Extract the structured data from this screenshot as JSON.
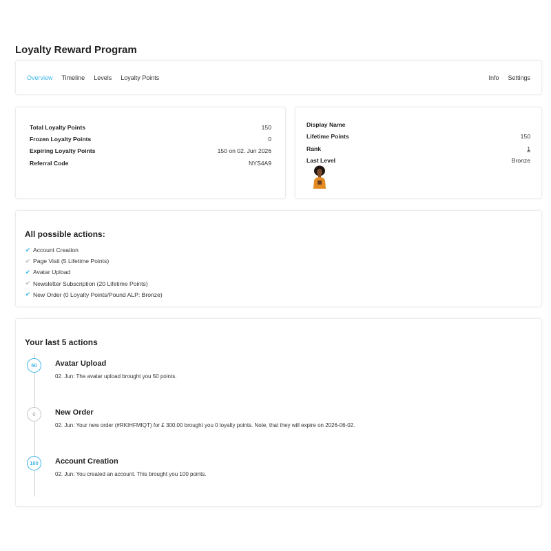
{
  "page": {
    "title": "Loyalty Reward Program"
  },
  "nav": {
    "left": [
      "Overview",
      "Timeline",
      "Levels",
      "Loyalty Points"
    ],
    "right": [
      "Info",
      "Settings"
    ],
    "active": "Overview",
    "accent_color": "#3cb4e6"
  },
  "stats": {
    "total": {
      "label": "Total Loyalty Points",
      "value": "150"
    },
    "frozen": {
      "label": "Frozen Loyalty Points",
      "value": "0"
    },
    "expiring": {
      "label": "Expiring Loyalty Points",
      "value": "150 on 02. Jun 2026"
    },
    "referral": {
      "label": "Referral Code",
      "value": "NYS4A9"
    }
  },
  "profile": {
    "display_name": {
      "label": "Display Name",
      "value": ""
    },
    "lifetime": {
      "label": "Lifetime Points",
      "value": "150"
    },
    "rank": {
      "label": "Rank",
      "value": "1"
    },
    "last_level": {
      "label": "Last Level",
      "value": "Bronze"
    },
    "avatar_icon": "avatar-image"
  },
  "actions": {
    "title": "All possible actions:",
    "items": [
      {
        "label": "Account Creation",
        "done": true,
        "icon": "check-icon"
      },
      {
        "label": "Page Visit (5 Lifetime Points)",
        "done": false,
        "icon": "check-icon"
      },
      {
        "label": "Avatar Upload",
        "done": true,
        "icon": "check-icon"
      },
      {
        "label": "Newsletter Subscription (20 Lifetime Points)",
        "done": false,
        "icon": "check-icon"
      },
      {
        "label": "New Order (0 Loyalty Points/Pound ALP: Bronze)",
        "done": true,
        "icon": "check-icon"
      }
    ]
  },
  "timeline": {
    "title": "Your last 5 actions",
    "items": [
      {
        "points": "50",
        "title": "Avatar Upload",
        "desc": "02. Jun: The avatar upload brought you 50 points.",
        "highlight": true
      },
      {
        "points": "0",
        "title": "New Order",
        "desc": "02. Jun: Your new order (#RKIHFMIQT) for £ 300.00 brought you 0 loyalty points. Note, that they will expire on 2026-06-02.",
        "highlight": false
      },
      {
        "points": "100",
        "title": "Account Creation",
        "desc": "02. Jun: You created an account. This brought you 100 points.",
        "highlight": true
      }
    ]
  }
}
